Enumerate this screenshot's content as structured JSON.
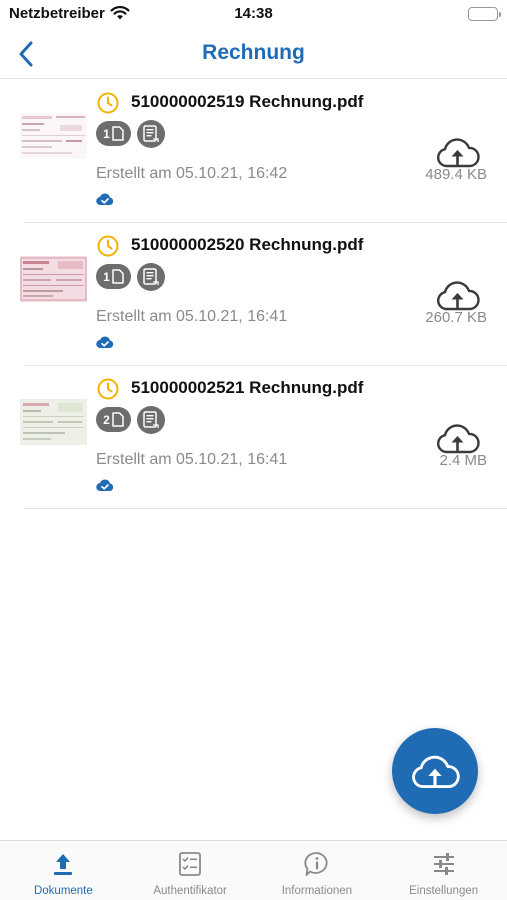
{
  "status_bar": {
    "carrier": "Netzbetreiber",
    "time": "14:38"
  },
  "nav": {
    "title": "Rechnung",
    "back_icon": "chevron-left-icon"
  },
  "colors": {
    "accent": "#1f6cb4",
    "pending": "#f0b400",
    "badge": "#6d6d70",
    "muted": "#8a8a8e"
  },
  "documents": [
    {
      "name": "510000002519 Rechnung.pdf",
      "pages": "1",
      "created": "Erstellt am 05.10.21, 16:42",
      "size": "489.4 KB",
      "status_icon": "clock-icon",
      "sync_icon": "cloud-check-icon"
    },
    {
      "name": "510000002520 Rechnung.pdf",
      "pages": "1",
      "created": "Erstellt am 05.10.21, 16:41",
      "size": "260.7 KB",
      "status_icon": "clock-icon",
      "sync_icon": "cloud-check-icon"
    },
    {
      "name": "510000002521 Rechnung.pdf",
      "pages": "2",
      "created": "Erstellt am 05.10.21, 16:41",
      "size": "2.4 MB",
      "status_icon": "clock-icon",
      "sync_icon": "cloud-check-icon"
    }
  ],
  "fab": {
    "icon": "cloud-upload-icon"
  },
  "tabs": [
    {
      "label": "Dokumente",
      "icon": "upload-arrow-icon",
      "active": true
    },
    {
      "label": "Authentifikator",
      "icon": "checklist-icon",
      "active": false
    },
    {
      "label": "Informationen",
      "icon": "info-bubble-icon",
      "active": false
    },
    {
      "label": "Einstellungen",
      "icon": "sliders-icon",
      "active": false
    }
  ]
}
